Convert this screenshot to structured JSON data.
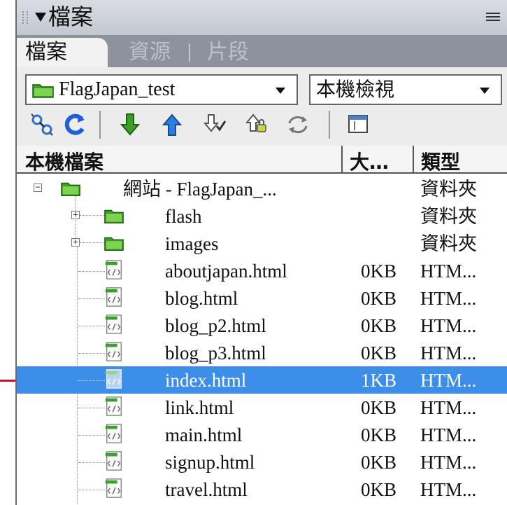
{
  "panel": {
    "title": "檔案",
    "tabs": [
      {
        "label": "檔案",
        "active": true
      },
      {
        "label": "資源",
        "active": false
      },
      {
        "label": "片段",
        "active": false
      }
    ]
  },
  "toolbar": {
    "site_select_value": "FlagJapan_test",
    "view_select_value": "本機檢視",
    "icons": [
      "connect-icon",
      "refresh-icon",
      "get-files-icon",
      "put-files-icon",
      "check-out-icon",
      "check-in-icon",
      "synchronize-icon",
      "expand-view-icon"
    ]
  },
  "columns": {
    "name": "本機檔案",
    "size": "大…",
    "type": "類型"
  },
  "tree": {
    "site": {
      "name": "網站 - FlagJapan_...",
      "type": "資料夾"
    },
    "folders": [
      {
        "name": "flash",
        "type": "資料夾"
      },
      {
        "name": "images",
        "type": "資料夾"
      }
    ],
    "files": [
      {
        "name": "aboutjapan.html",
        "size": "0KB",
        "type": "HTM...",
        "selected": false
      },
      {
        "name": "blog.html",
        "size": "0KB",
        "type": "HTM...",
        "selected": false
      },
      {
        "name": "blog_p2.html",
        "size": "0KB",
        "type": "HTM...",
        "selected": false
      },
      {
        "name": "blog_p3.html",
        "size": "0KB",
        "type": "HTM...",
        "selected": false
      },
      {
        "name": "index.html",
        "size": "1KB",
        "type": "HTM...",
        "selected": true
      },
      {
        "name": "link.html",
        "size": "0KB",
        "type": "HTM...",
        "selected": false
      },
      {
        "name": "main.html",
        "size": "0KB",
        "type": "HTM...",
        "selected": false
      },
      {
        "name": "signup.html",
        "size": "0KB",
        "type": "HTM...",
        "selected": false
      },
      {
        "name": "travel.html",
        "size": "0KB",
        "type": "HTM...",
        "selected": false
      }
    ]
  },
  "colors": {
    "selection": "#3d8ee8",
    "callout": "#c8102e",
    "folder": "#3aa02a"
  }
}
